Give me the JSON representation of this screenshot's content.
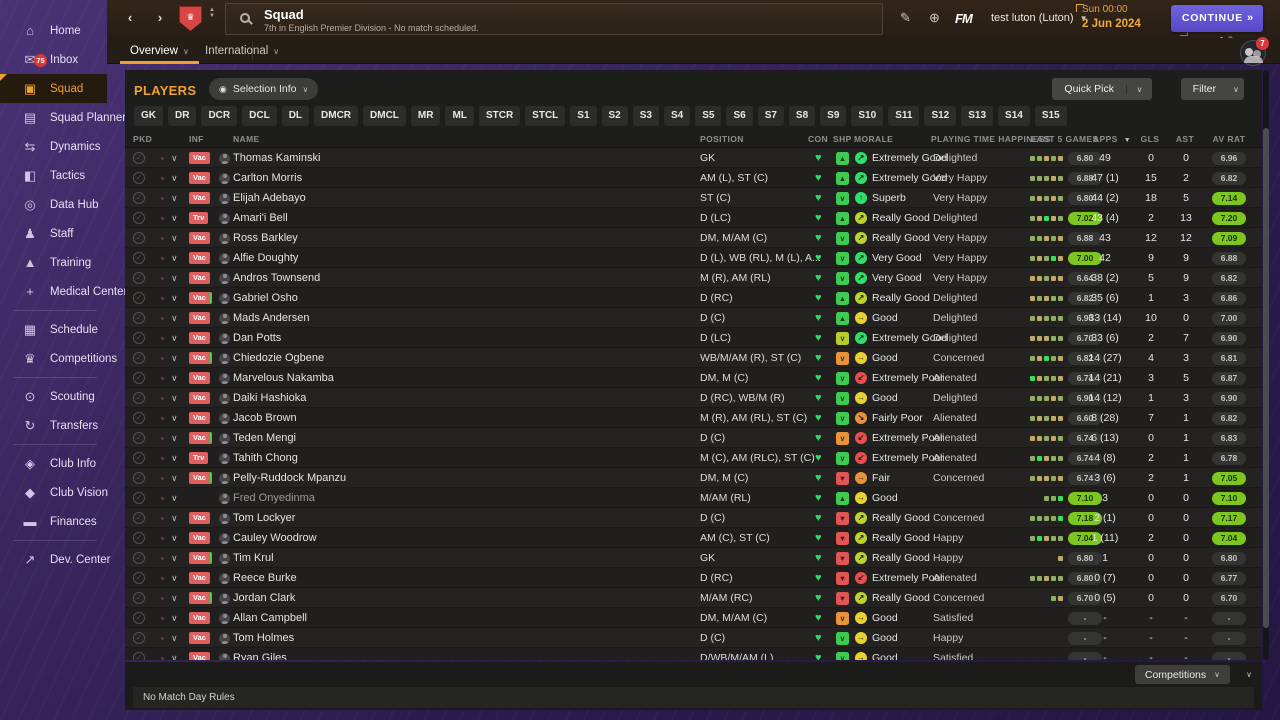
{
  "colors": {
    "accent_orange": "#f0a030",
    "continue_purple": "#645bd2",
    "badge_red": "#e06060",
    "pill_green": "#7dc61f",
    "heart_green": "#2ee06a"
  },
  "sidebar": {
    "items": [
      {
        "id": "home",
        "label": "Home",
        "icon": "home-icon"
      },
      {
        "id": "inbox",
        "label": "Inbox",
        "icon": "inbox-icon",
        "badge": "75"
      },
      {
        "id": "squad",
        "label": "Squad",
        "icon": "shirt-icon",
        "active": true
      },
      {
        "id": "squad-planner",
        "label": "Squad Planner",
        "icon": "clipboard-icon"
      },
      {
        "id": "dynamics",
        "label": "Dynamics",
        "icon": "dynamics-icon"
      },
      {
        "id": "tactics",
        "label": "Tactics",
        "icon": "tactics-icon"
      },
      {
        "id": "data-hub",
        "label": "Data Hub",
        "icon": "data-hub-icon"
      },
      {
        "id": "staff",
        "label": "Staff",
        "icon": "staff-icon"
      },
      {
        "id": "training",
        "label": "Training",
        "icon": "training-icon"
      },
      {
        "id": "medical-center",
        "label": "Medical Center",
        "icon": "medical-icon",
        "divider_after": true
      },
      {
        "id": "schedule",
        "label": "Schedule",
        "icon": "calendar-icon"
      },
      {
        "id": "competitions",
        "label": "Competitions",
        "icon": "trophy-icon",
        "divider_after": true
      },
      {
        "id": "scouting",
        "label": "Scouting",
        "icon": "scouting-icon"
      },
      {
        "id": "transfers",
        "label": "Transfers",
        "icon": "transfers-icon",
        "divider_after": true
      },
      {
        "id": "club-info",
        "label": "Club Info",
        "icon": "club-shield-icon"
      },
      {
        "id": "club-vision",
        "label": "Club Vision",
        "icon": "briefcase-icon"
      },
      {
        "id": "finances",
        "label": "Finances",
        "icon": "money-icon",
        "divider_after": true
      },
      {
        "id": "dev-center",
        "label": "Dev. Center",
        "icon": "growth-icon"
      }
    ]
  },
  "header": {
    "title": "Squad",
    "subtitle": "7th in English Premier Division - No match scheduled.",
    "manager": "test luton (Luton)",
    "clock": "Sun 00:00",
    "date": "2 Jun 2024",
    "continue_label": "CONTINUE",
    "continue_arrow": "»",
    "fm_label": "FM",
    "continue_sub_count": "2",
    "notif_badge": "7"
  },
  "tabs": [
    {
      "label": "Overview",
      "active": true
    },
    {
      "label": "International",
      "active": false
    }
  ],
  "panel": {
    "players_label": "PLAYERS",
    "selection_info_label": "Selection Info",
    "quick_pick_label": "Quick Pick",
    "filter_label": "Filter",
    "position_filters": [
      "GK",
      "DR",
      "DCR",
      "DCL",
      "DL",
      "DMCR",
      "DMCL",
      "MR",
      "ML",
      "STCR",
      "STCL",
      "S1",
      "S2",
      "S3",
      "S4",
      "S5",
      "S6",
      "S7",
      "S8",
      "S9",
      "S10",
      "S11",
      "S12",
      "S13",
      "S14",
      "S15"
    ],
    "columns": [
      "PKD",
      "INF",
      "NAME",
      "POSITION",
      "CON",
      "SHP",
      "MORALE",
      "PLAYING TIME HAPPINESS",
      "LAST 5 GAMES",
      "APPS",
      "GLS",
      "AST",
      "AV RAT"
    ],
    "sorted_column": "APPS"
  },
  "players": [
    {
      "name": "Thomas Kaminski",
      "inf": "Vac",
      "inf_green": false,
      "dim": false,
      "pos": "GK",
      "shp": {
        "type": "up",
        "tone": "green"
      },
      "morale": {
        "label": "Extremely Good",
        "tone": "green",
        "dir": "ne"
      },
      "hap": "Delighted",
      "l5": {
        "marks": [
          "g",
          "g",
          "t",
          "g",
          "t"
        ],
        "rating": "6.80",
        "hot": false
      },
      "apps": "49",
      "gls": "0",
      "ast": "0",
      "avr": {
        "value": "6.96",
        "hot": false
      }
    },
    {
      "name": "Carlton Morris",
      "inf": "Vac",
      "inf_green": false,
      "dim": false,
      "pos": "AM (L), ST (C)",
      "shp": {
        "type": "up",
        "tone": "green"
      },
      "morale": {
        "label": "Extremely Good",
        "tone": "green",
        "dir": "ne"
      },
      "hap": "Very Happy",
      "l5": {
        "marks": [
          "g",
          "g",
          "g",
          "t",
          "g"
        ],
        "rating": "6.88",
        "hot": false
      },
      "apps": "47 (1)",
      "gls": "15",
      "ast": "2",
      "avr": {
        "value": "6.82",
        "hot": false
      }
    },
    {
      "name": "Elijah Adebayo",
      "inf": "Vac",
      "inf_green": false,
      "dim": false,
      "pos": "ST (C)",
      "shp": {
        "type": "chev",
        "tone": "green"
      },
      "morale": {
        "label": "Superb",
        "tone": "green",
        "dir": "n"
      },
      "hap": "Very Happy",
      "l5": {
        "marks": [
          "g",
          "t",
          "g",
          "t",
          "g"
        ],
        "rating": "6.80",
        "hot": false
      },
      "apps": "44 (2)",
      "gls": "18",
      "ast": "5",
      "avr": {
        "value": "7.14",
        "hot": true
      }
    },
    {
      "name": "Amari'i Bell",
      "inf": "Trv",
      "inf_green": false,
      "dim": false,
      "pos": "D (LC)",
      "shp": {
        "type": "up",
        "tone": "green"
      },
      "morale": {
        "label": "Really Good",
        "tone": "lg",
        "dir": "ne"
      },
      "hap": "Delighted",
      "l5": {
        "marks": [
          "g",
          "t",
          "G",
          "t",
          "g"
        ],
        "rating": "7.02",
        "hot": true
      },
      "apps": "43 (4)",
      "gls": "2",
      "ast": "13",
      "avr": {
        "value": "7.20",
        "hot": true
      }
    },
    {
      "name": "Ross Barkley",
      "inf": "Vac",
      "inf_green": false,
      "dim": false,
      "pos": "DM, M/AM (C)",
      "shp": {
        "type": "chev",
        "tone": "green"
      },
      "morale": {
        "label": "Really Good",
        "tone": "lg",
        "dir": "ne"
      },
      "hap": "Very Happy",
      "l5": {
        "marks": [
          "g",
          "g",
          "t",
          "g",
          "t"
        ],
        "rating": "6.88",
        "hot": false
      },
      "apps": "43",
      "gls": "12",
      "ast": "12",
      "avr": {
        "value": "7.09",
        "hot": true
      }
    },
    {
      "name": "Alfie Doughty",
      "inf": "Vac",
      "inf_green": false,
      "dim": false,
      "pos": "D (L), WB (RL), M (L), A...",
      "shp": {
        "type": "chev",
        "tone": "green"
      },
      "morale": {
        "label": "Very Good",
        "tone": "green",
        "dir": "ne"
      },
      "hap": "Very Happy",
      "l5": {
        "marks": [
          "g",
          "t",
          "g",
          "G",
          "t"
        ],
        "rating": "7.00",
        "hot": true
      },
      "apps": "42",
      "gls": "9",
      "ast": "9",
      "avr": {
        "value": "6.88",
        "hot": false
      }
    },
    {
      "name": "Andros Townsend",
      "inf": "Vac",
      "inf_green": false,
      "dim": false,
      "pos": "M (R), AM (RL)",
      "shp": {
        "type": "chev",
        "tone": "green"
      },
      "morale": {
        "label": "Very Good",
        "tone": "green",
        "dir": "ne"
      },
      "hap": "Very Happy",
      "l5": {
        "marks": [
          "t",
          "t",
          "g",
          "t",
          "t"
        ],
        "rating": "6.64",
        "hot": false
      },
      "apps": "38 (2)",
      "gls": "5",
      "ast": "9",
      "avr": {
        "value": "6.82",
        "hot": false
      }
    },
    {
      "name": "Gabriel Osho",
      "inf": "Vac",
      "inf_green": true,
      "dim": false,
      "pos": "D (RC)",
      "shp": {
        "type": "up",
        "tone": "green"
      },
      "morale": {
        "label": "Really Good",
        "tone": "lg",
        "dir": "ne"
      },
      "hap": "Delighted",
      "l5": {
        "marks": [
          "t",
          "g",
          "t",
          "g",
          "g"
        ],
        "rating": "6.82",
        "hot": false
      },
      "apps": "35 (6)",
      "gls": "1",
      "ast": "3",
      "avr": {
        "value": "6.86",
        "hot": false
      }
    },
    {
      "name": "Mads Andersen",
      "inf": "Vac",
      "inf_green": false,
      "dim": false,
      "pos": "D (C)",
      "shp": {
        "type": "up",
        "tone": "green"
      },
      "morale": {
        "label": "Good",
        "tone": "yellow",
        "dir": "e"
      },
      "hap": "Delighted",
      "l5": {
        "marks": [
          "g",
          "t",
          "g",
          "g",
          "g"
        ],
        "rating": "6.90",
        "hot": false
      },
      "apps": "33 (14)",
      "gls": "10",
      "ast": "0",
      "avr": {
        "value": "7.00",
        "hot": false
      }
    },
    {
      "name": "Dan Potts",
      "inf": "Vac",
      "inf_green": false,
      "dim": false,
      "pos": "D (LC)",
      "shp": {
        "type": "chev",
        "tone": "lg"
      },
      "morale": {
        "label": "Extremely Good",
        "tone": "green",
        "dir": "ne"
      },
      "hap": "Delighted",
      "l5": {
        "marks": [
          "t",
          "t",
          "t",
          "g",
          "g"
        ],
        "rating": "6.70",
        "hot": false
      },
      "apps": "33 (6)",
      "gls": "2",
      "ast": "7",
      "avr": {
        "value": "6.90",
        "hot": false
      }
    },
    {
      "name": "Chiedozie Ogbene",
      "inf": "Vac",
      "inf_green": true,
      "dim": false,
      "pos": "WB/M/AM (R), ST (C)",
      "shp": {
        "type": "chev",
        "tone": "orange"
      },
      "morale": {
        "label": "Good",
        "tone": "yellow",
        "dir": "e"
      },
      "hap": "Concerned",
      "l5": {
        "marks": [
          "g",
          "t",
          "G",
          "g",
          "t"
        ],
        "rating": "6.82",
        "hot": false
      },
      "apps": "14 (27)",
      "gls": "4",
      "ast": "3",
      "avr": {
        "value": "6.81",
        "hot": false
      }
    },
    {
      "name": "Marvelous Nakamba",
      "inf": "Vac",
      "inf_green": false,
      "dim": false,
      "pos": "DM, M (C)",
      "shp": {
        "type": "chev",
        "tone": "green"
      },
      "morale": {
        "label": "Extremely Poor",
        "tone": "red",
        "dir": "sw"
      },
      "hap": "Alienated",
      "l5": {
        "marks": [
          "G",
          "t",
          "g",
          "g",
          "t"
        ],
        "rating": "6.74",
        "hot": false
      },
      "apps": "14 (21)",
      "gls": "3",
      "ast": "5",
      "avr": {
        "value": "6.87",
        "hot": false
      }
    },
    {
      "name": "Daiki Hashioka",
      "inf": "Vac",
      "inf_green": false,
      "dim": false,
      "pos": "D (RC), WB/M (R)",
      "shp": {
        "type": "chev",
        "tone": "green"
      },
      "morale": {
        "label": "Good",
        "tone": "yellow",
        "dir": "e"
      },
      "hap": "Delighted",
      "l5": {
        "marks": [
          "g",
          "g",
          "g",
          "t",
          "g"
        ],
        "rating": "6.90",
        "hot": false
      },
      "apps": "14 (12)",
      "gls": "1",
      "ast": "3",
      "avr": {
        "value": "6.90",
        "hot": false
      }
    },
    {
      "name": "Jacob Brown",
      "inf": "Vac",
      "inf_green": false,
      "dim": false,
      "pos": "M (R), AM (RL), ST (C)",
      "shp": {
        "type": "chev",
        "tone": "green"
      },
      "morale": {
        "label": "Fairly Poor",
        "tone": "orange",
        "dir": "se"
      },
      "hap": "Alienated",
      "l5": {
        "marks": [
          "g",
          "t",
          "g",
          "t",
          "t"
        ],
        "rating": "6.60",
        "hot": false
      },
      "apps": "8 (28)",
      "gls": "7",
      "ast": "1",
      "avr": {
        "value": "6.82",
        "hot": false
      }
    },
    {
      "name": "Teden Mengi",
      "inf": "Vac",
      "inf_green": true,
      "dim": false,
      "pos": "D (C)",
      "shp": {
        "type": "chev",
        "tone": "orange"
      },
      "morale": {
        "label": "Extremely Poor",
        "tone": "red",
        "dir": "sw"
      },
      "hap": "Alienated",
      "l5": {
        "marks": [
          "t",
          "t",
          "g",
          "t",
          "g"
        ],
        "rating": "6.74",
        "hot": false
      },
      "apps": "6 (13)",
      "gls": "0",
      "ast": "1",
      "avr": {
        "value": "6.83",
        "hot": false
      }
    },
    {
      "name": "Tahith Chong",
      "inf": "Trv",
      "inf_green": false,
      "dim": false,
      "pos": "M (C), AM (RLC), ST (C)",
      "shp": {
        "type": "chev",
        "tone": "green"
      },
      "morale": {
        "label": "Extremely Poor",
        "tone": "red",
        "dir": "sw"
      },
      "hap": "Alienated",
      "l5": {
        "marks": [
          "g",
          "G",
          "t",
          "g",
          "g"
        ],
        "rating": "6.74",
        "hot": false
      },
      "apps": "4 (8)",
      "gls": "2",
      "ast": "1",
      "avr": {
        "value": "6.78",
        "hot": false
      }
    },
    {
      "name": "Pelly-Ruddock Mpanzu",
      "inf": "Vac",
      "inf_green": true,
      "dim": false,
      "pos": "DM, M (C)",
      "shp": {
        "type": "down",
        "tone": "red"
      },
      "morale": {
        "label": "Fair",
        "tone": "orange",
        "dir": "e"
      },
      "hap": "Concerned",
      "l5": {
        "marks": [
          "g",
          "t",
          "t",
          "g",
          "t"
        ],
        "rating": "6.74",
        "hot": false
      },
      "apps": "3 (6)",
      "gls": "2",
      "ast": "1",
      "avr": {
        "value": "7.05",
        "hot": true
      }
    },
    {
      "name": "Fred Onyedinma",
      "inf": "",
      "inf_green": false,
      "dim": true,
      "pos": "M/AM (RL)",
      "shp": {
        "type": "up",
        "tone": "green"
      },
      "morale": {
        "label": "Good",
        "tone": "yellow",
        "dir": "e"
      },
      "hap": "",
      "l5": {
        "marks": [
          "g",
          "g",
          "G"
        ],
        "rating": "7.10",
        "hot": true
      },
      "apps": "3",
      "gls": "0",
      "ast": "0",
      "avr": {
        "value": "7.10",
        "hot": true
      }
    },
    {
      "name": "Tom Lockyer",
      "inf": "Vac",
      "inf_green": false,
      "dim": false,
      "pos": "D (C)",
      "shp": {
        "type": "down",
        "tone": "red"
      },
      "morale": {
        "label": "Really Good",
        "tone": "lg",
        "dir": "ne"
      },
      "hap": "Concerned",
      "l5": {
        "marks": [
          "g",
          "g",
          "g",
          "g",
          "G"
        ],
        "rating": "7.18",
        "hot": true
      },
      "apps": "2 (1)",
      "gls": "0",
      "ast": "0",
      "avr": {
        "value": "7.17",
        "hot": true
      }
    },
    {
      "name": "Cauley Woodrow",
      "inf": "Vac",
      "inf_green": false,
      "dim": false,
      "pos": "AM (C), ST (C)",
      "shp": {
        "type": "down",
        "tone": "red"
      },
      "morale": {
        "label": "Really Good",
        "tone": "lg",
        "dir": "ne"
      },
      "hap": "Happy",
      "l5": {
        "marks": [
          "g",
          "G",
          "t",
          "g",
          "g"
        ],
        "rating": "7.04",
        "hot": true
      },
      "apps": "1 (11)",
      "gls": "2",
      "ast": "0",
      "avr": {
        "value": "7.04",
        "hot": true
      }
    },
    {
      "name": "Tim Krul",
      "inf": "Vac",
      "inf_green": true,
      "dim": false,
      "pos": "GK",
      "shp": {
        "type": "down",
        "tone": "red"
      },
      "morale": {
        "label": "Really Good",
        "tone": "lg",
        "dir": "ne"
      },
      "hap": "Happy",
      "l5": {
        "marks": [
          "t"
        ],
        "rating": "6.80",
        "hot": false
      },
      "apps": "1",
      "gls": "0",
      "ast": "0",
      "avr": {
        "value": "6.80",
        "hot": false
      }
    },
    {
      "name": "Reece Burke",
      "inf": "Vac",
      "inf_green": false,
      "dim": false,
      "pos": "D (RC)",
      "shp": {
        "type": "down",
        "tone": "red"
      },
      "morale": {
        "label": "Extremely Poor",
        "tone": "red",
        "dir": "sw"
      },
      "hap": "Alienated",
      "l5": {
        "marks": [
          "g",
          "g",
          "t",
          "g",
          "g"
        ],
        "rating": "6.80",
        "hot": false
      },
      "apps": "0 (7)",
      "gls": "0",
      "ast": "0",
      "avr": {
        "value": "6.77",
        "hot": false
      }
    },
    {
      "name": "Jordan Clark",
      "inf": "Vac",
      "inf_green": true,
      "dim": false,
      "pos": "M/AM (RC)",
      "shp": {
        "type": "down",
        "tone": "red"
      },
      "morale": {
        "label": "Really Good",
        "tone": "lg",
        "dir": "ne"
      },
      "hap": "Concerned",
      "l5": {
        "marks": [
          "g",
          "t"
        ],
        "rating": "6.70",
        "hot": false
      },
      "apps": "0 (5)",
      "gls": "0",
      "ast": "0",
      "avr": {
        "value": "6.70",
        "hot": false
      }
    },
    {
      "name": "Allan Campbell",
      "inf": "Vac",
      "inf_green": false,
      "dim": false,
      "pos": "DM, M/AM (C)",
      "shp": {
        "type": "chev",
        "tone": "orange"
      },
      "morale": {
        "label": "Good",
        "tone": "yellow",
        "dir": "e"
      },
      "hap": "Satisfied",
      "l5": {
        "marks": [],
        "rating": "-",
        "hot": false
      },
      "apps": "-",
      "gls": "-",
      "ast": "-",
      "avr": {
        "value": "-",
        "hot": false
      }
    },
    {
      "name": "Tom Holmes",
      "inf": "Vac",
      "inf_green": false,
      "dim": false,
      "pos": "D (C)",
      "shp": {
        "type": "chev",
        "tone": "green"
      },
      "morale": {
        "label": "Good",
        "tone": "yellow",
        "dir": "e"
      },
      "hap": "Happy",
      "l5": {
        "marks": [],
        "rating": "-",
        "hot": false
      },
      "apps": "-",
      "gls": "-",
      "ast": "-",
      "avr": {
        "value": "-",
        "hot": false
      }
    },
    {
      "name": "Ryan Giles",
      "inf": "Vac",
      "inf_green": false,
      "dim": false,
      "pos": "D/WB/M/AM (L)",
      "shp": {
        "type": "chev",
        "tone": "green"
      },
      "morale": {
        "label": "Good",
        "tone": "yellow",
        "dir": "e"
      },
      "hap": "Satisfied",
      "l5": {
        "marks": [],
        "rating": "-",
        "hot": false
      },
      "apps": "-",
      "gls": "-",
      "ast": "-",
      "avr": {
        "value": "-",
        "hot": false
      }
    }
  ],
  "footer": {
    "competitions_label": "Competitions",
    "no_rules_text": "No Match Day Rules"
  }
}
